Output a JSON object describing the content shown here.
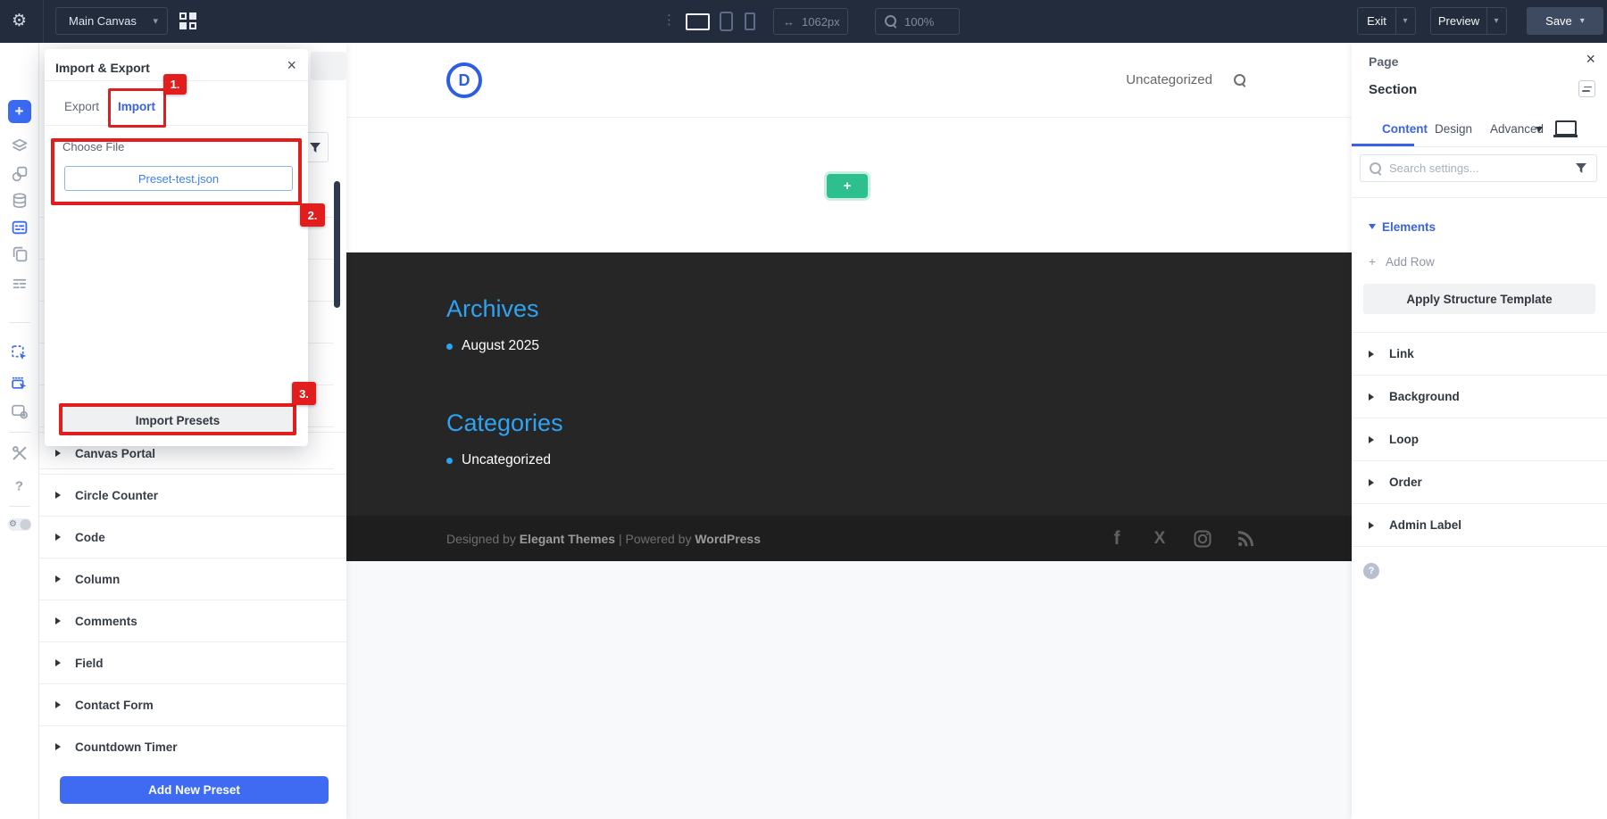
{
  "colors": {
    "toolbar_bg": "#222c3d",
    "accent_blue": "#3b6bf2",
    "tab_blue": "#3b62e3",
    "page_link_blue": "#2ea3f2",
    "annotation_red": "#e21d1d",
    "add_green": "#2dbf8e",
    "dark_section_bg": "#262626",
    "footer_bg": "#1e1e1e"
  },
  "icons": {
    "gear": "⚙",
    "dots": "⋮",
    "chevron_down": "▾",
    "width_arrows": "↔",
    "plus": "+",
    "question": "?",
    "close": "×",
    "facebook": "f",
    "x_twitter": "X"
  },
  "toolbar": {
    "canvas_selector": "Main Canvas",
    "width_value": "1062px",
    "zoom_value": "100%",
    "exit_label": "Exit",
    "preview_label": "Preview",
    "save_label": "Save"
  },
  "presets_panel": {
    "items": [
      "Canvas Portal",
      "Circle Counter",
      "Code",
      "Column",
      "Comments",
      "Field",
      "Contact Form",
      "Countdown Timer"
    ],
    "add_button": "Add New Preset"
  },
  "modal": {
    "title": "Import & Export",
    "export_tab": "Export",
    "import_tab": "Import",
    "choose_file_label": "Choose File",
    "file_name": "Preset-test.json",
    "import_button": "Import Presets",
    "badge_1": "1.",
    "badge_2": "2.",
    "badge_3": "3."
  },
  "page": {
    "logo_letter": "D",
    "nav_item": "Uncategorized",
    "archives_title": "Archives",
    "archives_items": [
      "August 2025"
    ],
    "categories_title": "Categories",
    "categories_items": [
      "Uncategorized"
    ],
    "footer": {
      "designed_by": "Designed by",
      "designer": "Elegant Themes",
      "separator": "|",
      "powered_by": "Powered by",
      "platform": "WordPress"
    }
  },
  "right_panel": {
    "title": "Page",
    "element_label": "Section",
    "tabs": [
      "Content",
      "Design",
      "Advanced"
    ],
    "search_placeholder": "Search settings...",
    "elements_label": "Elements",
    "add_row_label": "Add Row",
    "apply_button": "Apply Structure Template",
    "groups": [
      "Link",
      "Background",
      "Loop",
      "Order",
      "Admin Label"
    ]
  }
}
